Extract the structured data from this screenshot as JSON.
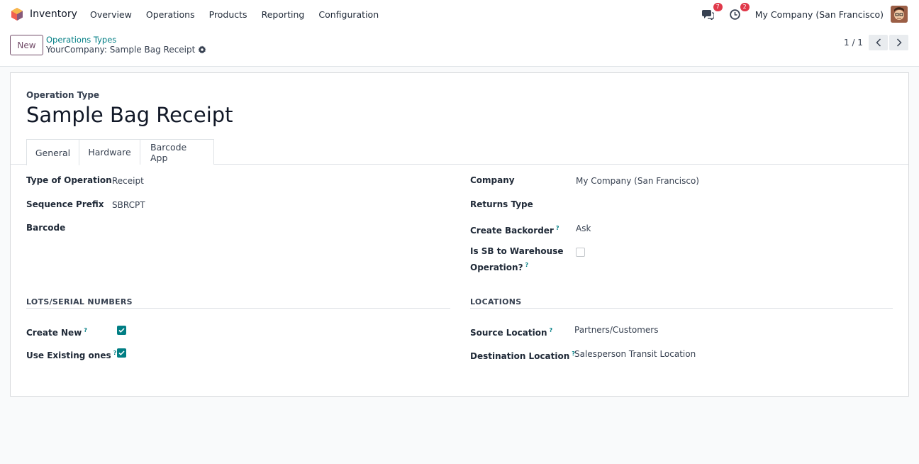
{
  "navbar": {
    "app_name": "Inventory",
    "menu": [
      "Overview",
      "Operations",
      "Products",
      "Reporting",
      "Configuration"
    ],
    "messages_count": "7",
    "activities_count": "2",
    "company": "My Company (San Francisco)"
  },
  "control_panel": {
    "new_label": "New",
    "breadcrumb_parent": "Operations Types",
    "breadcrumb_current": "YourCompany: Sample Bag Receipt",
    "pager": "1 / 1"
  },
  "form": {
    "type_label": "Operation Type",
    "title": "Sample Bag Receipt",
    "tabs": [
      "General",
      "Hardware",
      "Barcode App"
    ],
    "active_tab": "General",
    "left": {
      "type_of_operation_label": "Type of Operation",
      "type_of_operation_value": "Receipt",
      "sequence_prefix_label": "Sequence Prefix",
      "sequence_prefix_value": "SBRCPT",
      "barcode_label": "Barcode"
    },
    "right": {
      "company_label": "Company",
      "company_value": "My Company (San Francisco)",
      "returns_type_label": "Returns Type",
      "create_backorder_label": "Create Backorder",
      "create_backorder_value": "Ask",
      "is_sb_label_line1": "Is SB to Warehouse",
      "is_sb_label_line2": "Operation?",
      "is_sb_checked": false
    },
    "lots": {
      "title": "LOTS/SERIAL NUMBERS",
      "create_new_label": "Create New",
      "create_new_checked": true,
      "use_existing_label": "Use Existing ones",
      "use_existing_checked": true
    },
    "locations": {
      "title": "LOCATIONS",
      "source_label": "Source Location",
      "source_value": "Partners/Customers",
      "destination_label": "Destination Location",
      "destination_value": "Salesperson Transit Location"
    },
    "help_marker": "?"
  },
  "colors": {
    "brand": "#714b67",
    "accent": "#017e84",
    "badge": "#e0394a"
  }
}
